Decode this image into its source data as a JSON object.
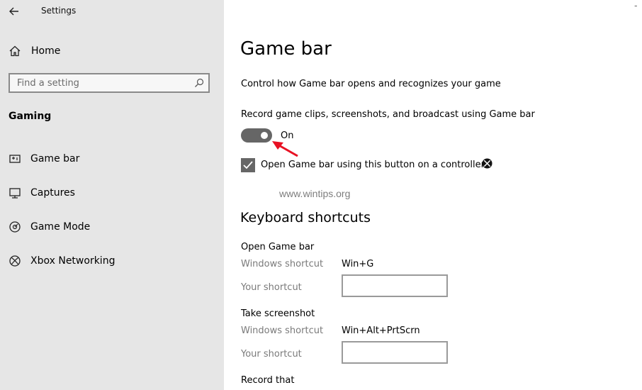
{
  "window": {
    "title": "Settings",
    "close_glyph": "ˉ"
  },
  "sidebar": {
    "home_label": "Home",
    "search": {
      "placeholder": "Find a setting"
    },
    "section_title": "Gaming",
    "items": [
      {
        "label": "Game bar",
        "icon": "game-bar-icon"
      },
      {
        "label": "Captures",
        "icon": "captures-icon"
      },
      {
        "label": "Game Mode",
        "icon": "game-mode-icon"
      },
      {
        "label": "Xbox Networking",
        "icon": "xbox-icon"
      }
    ]
  },
  "main": {
    "title": "Game bar",
    "description": "Control how Game bar opens and recognizes your game",
    "record_label": "Record game clips, screenshots, and broadcast using Game bar",
    "toggle_state": "On",
    "checkbox_label": "Open Game bar using this button on a controller:",
    "watermark": "www.wintips.org",
    "shortcuts_title": "Keyboard shortcuts",
    "groups": [
      {
        "title": "Open Game bar",
        "windows_label": "Windows shortcut",
        "windows_value": "Win+G",
        "your_label": "Your shortcut"
      },
      {
        "title": "Take screenshot",
        "windows_label": "Windows shortcut",
        "windows_value": "Win+Alt+PrtScrn",
        "your_label": "Your shortcut"
      },
      {
        "title": "Record that"
      }
    ]
  },
  "colors": {
    "sidebar_bg": "#e6e6e6",
    "toggle_on": "#666666",
    "annotation_arrow": "#e81123"
  }
}
